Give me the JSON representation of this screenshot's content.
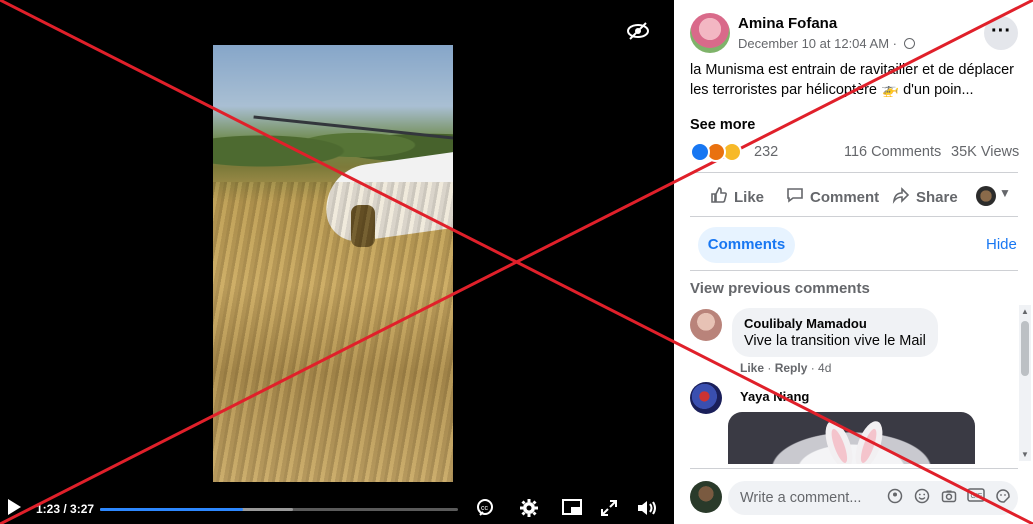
{
  "video": {
    "time_display": "1:23 / 3:27",
    "progress": 0.4,
    "buffered": 0.54,
    "icons": [
      "hide-eye-icon",
      "play-icon",
      "captions-icon",
      "settings-icon",
      "picture-in-picture-icon",
      "fullscreen-icon",
      "volume-icon"
    ]
  },
  "post": {
    "author": "Amina Fofana",
    "date": "December 10 at 12:04 AM · ",
    "text": "la Munisma est entrain de ravitailler et de déplacer les terroristes par hélicoptère 🚁 d'un poin...",
    "see_more": "See more",
    "reaction_count": "232",
    "comments_count": "116 Comments",
    "views": "35K Views"
  },
  "actions": {
    "like": "Like",
    "comment": "Comment",
    "share": "Share"
  },
  "comments_section": {
    "tab_label": "Comments",
    "hide_label": "Hide",
    "view_previous": "View previous comments",
    "items": [
      {
        "name": "Coulibaly Mamadou",
        "text": "Vive la transition vive le Mail",
        "like": "Like",
        "reply": "Reply",
        "age": "4d"
      },
      {
        "name": "Yaya Niang"
      }
    ],
    "input_placeholder": "Write a comment..."
  },
  "colors": {
    "accent": "#1877f2",
    "cross_red": "#e0202a",
    "progress_blue": "#2d88ff"
  }
}
